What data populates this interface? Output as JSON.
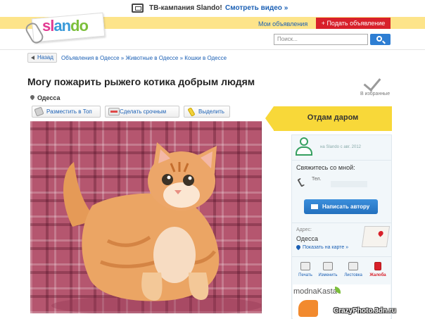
{
  "promo": {
    "text": "ТВ-кампания Slando!",
    "link": "Смотреть видео »"
  },
  "header": {
    "logo": {
      "part1": "sl",
      "part2": "an",
      "part3": "do"
    },
    "my_ads": "Мои объявления",
    "post_ad": "+ Подать объявление",
    "search_placeholder": "Поиск..."
  },
  "breadcrumb": {
    "back": "Назад",
    "path": "Объявления в Одессе » Животные в Одессе » Кошки в Одессе"
  },
  "ad": {
    "title": "Могу пожарить рыжего котика добрым людям",
    "favorite": "В избранные",
    "city": "Одесса",
    "actions": [
      "Разместить в Топ",
      "Сделать срочным",
      "Выделить"
    ]
  },
  "photo": {
    "subject": "orange-kitten",
    "watermark": "slando"
  },
  "sidebar": {
    "price": "Отдам даром",
    "user_since": "на Slando с авг. 2012",
    "contact_title": "Свяжитесь со мной:",
    "tel_label": "Тел.",
    "write_button": "Написать автору",
    "address_label": "Адрес:",
    "address_value": "Одесса",
    "map_link": "Показать на карте »",
    "tools": [
      "Печать",
      "Изменить",
      "Листовка",
      "Жалоба"
    ]
  },
  "banner": {
    "brand": "modnaKasta"
  },
  "site_watermark": "CrazyPhoto.3dn.ru",
  "colors": {
    "accent_yellow": "#f8d839",
    "header_yellow": "#fde48a",
    "link_blue": "#1a5fb4",
    "post_red": "#d8202a"
  }
}
